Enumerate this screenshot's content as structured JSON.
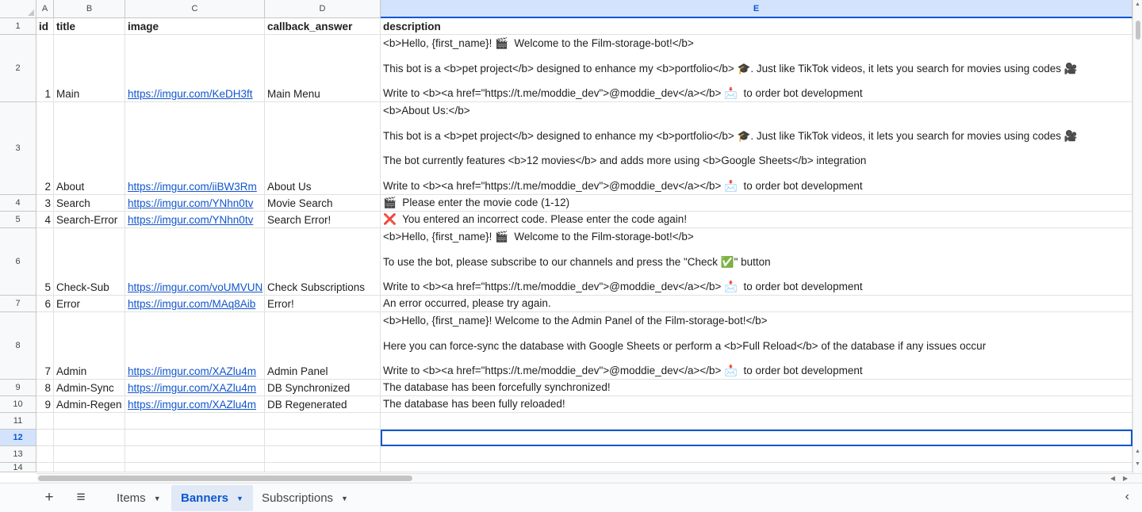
{
  "columns": [
    "A",
    "B",
    "C",
    "D",
    "E"
  ],
  "row_numbers": [
    "1",
    "2",
    "3",
    "4",
    "5",
    "6",
    "7",
    "8",
    "9",
    "10",
    "11",
    "12",
    "13",
    "14"
  ],
  "header": {
    "id": "id",
    "title": "title",
    "image": "image",
    "callback_answer": "callback_answer",
    "description": "description"
  },
  "rows": [
    {
      "id": "1",
      "title": "Main",
      "image": "https://imgur.com/KeDH3ft",
      "callback_answer": "Main Menu",
      "description": [
        "<b>Hello, {first_name}! 🎬  Welcome to the Film-storage-bot!</b>",
        "This bot is a <b>pet project</b> designed to enhance my <b>portfolio</b> 🎓. Just like TikTok videos, it lets you search for movies using codes 🎥",
        "Write to <b><a href=\"https://t.me/moddie_dev\">@moddie_dev</a></b> 📩  to order bot development"
      ]
    },
    {
      "id": "2",
      "title": "About",
      "image": "https://imgur.com/iiBW3Rm",
      "callback_answer": "About Us",
      "description": [
        "<b>About Us:</b>",
        "This bot is a <b>pet project</b> designed to enhance my <b>portfolio</b> 🎓. Just like TikTok videos, it lets you search for movies using codes 🎥",
        "The bot currently features <b>12 movies</b> and adds more using <b>Google Sheets</b> integration",
        "Write to <b><a href=\"https://t.me/moddie_dev\">@moddie_dev</a></b> 📩  to order bot development"
      ]
    },
    {
      "id": "3",
      "title": "Search",
      "image": "https://imgur.com/YNhn0tv",
      "callback_answer": "Movie Search",
      "description": [
        "🎬  Please enter the movie code (1-12)"
      ]
    },
    {
      "id": "4",
      "title": "Search-Error",
      "image": "https://imgur.com/YNhn0tv",
      "callback_answer": "Search Error!",
      "description": [
        "❌  You entered an incorrect code. Please enter the code again!"
      ]
    },
    {
      "id": "5",
      "title": "Check-Sub",
      "image": "https://imgur.com/voUMVUN",
      "callback_answer": "Check Subscriptions",
      "description": [
        "<b>Hello, {first_name}! 🎬  Welcome to the Film-storage-bot!</b>",
        "To use the bot, please subscribe to our channels and press the \"Check ✅\" button",
        "Write to <b><a href=\"https://t.me/moddie_dev\">@moddie_dev</a></b> 📩  to order bot development"
      ]
    },
    {
      "id": "6",
      "title": "Error",
      "image": "https://imgur.com/MAq8Aib",
      "callback_answer": "Error!",
      "description": [
        "An error occurred, please try again."
      ]
    },
    {
      "id": "7",
      "title": "Admin",
      "image": "https://imgur.com/XAZlu4m",
      "callback_answer": "Admin Panel",
      "description": [
        "<b>Hello, {first_name}! Welcome to the Admin Panel of the Film-storage-bot!</b>",
        "Here you can force-sync the database with Google Sheets or perform a <b>Full Reload</b> of the database if any issues occur",
        "Write to <b><a href=\"https://t.me/moddie_dev\">@moddie_dev</a></b> 📩  to order bot development"
      ]
    },
    {
      "id": "8",
      "title": "Admin-Sync",
      "image": "https://imgur.com/XAZlu4m",
      "callback_answer": "DB Synchronized",
      "description": [
        "The database has been forcefully synchronized!"
      ]
    },
    {
      "id": "9",
      "title": "Admin-Regen",
      "image": "https://imgur.com/XAZlu4m",
      "callback_answer": "DB Regenerated",
      "description": [
        "The database has been fully reloaded!"
      ]
    }
  ],
  "selection": {
    "active_column": "E",
    "active_row": "12"
  },
  "sheet_tabs": [
    {
      "label": "Items",
      "active": false
    },
    {
      "label": "Banners",
      "active": true
    },
    {
      "label": "Subscriptions",
      "active": false
    }
  ],
  "icons": {
    "add_sheet": "plus-icon",
    "all_sheets": "menu-icon",
    "collapse": "chevron-left-icon"
  },
  "colors": {
    "accent": "#0b57d0",
    "link": "#1155cc",
    "selected_header": "#d3e3fd",
    "active_tab_bg": "#e1e9f7"
  }
}
